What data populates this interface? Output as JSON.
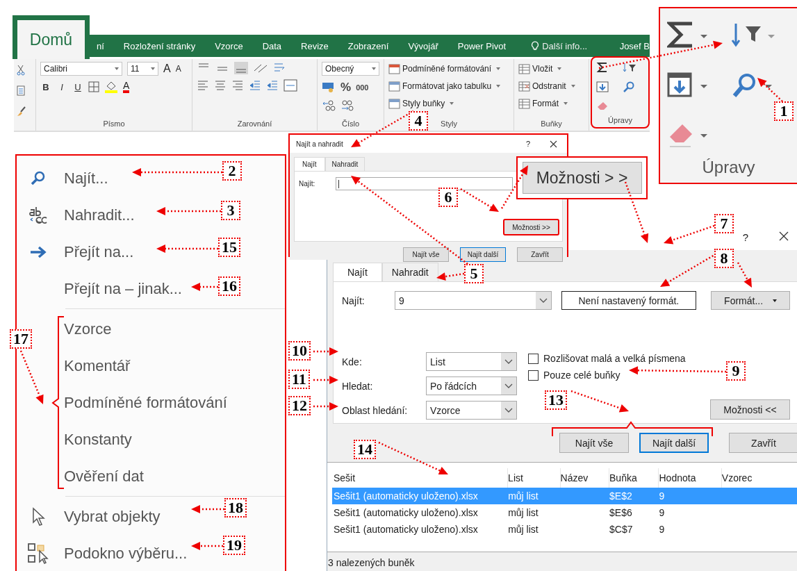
{
  "ribbon": {
    "tabs": [
      {
        "label": "Domů",
        "selected": true
      },
      {
        "label": "ní",
        "selected": false
      },
      {
        "label": "Rozložení stránky",
        "selected": false
      },
      {
        "label": "Vzorce",
        "selected": false
      },
      {
        "label": "Data",
        "selected": false
      },
      {
        "label": "Revize",
        "selected": false
      },
      {
        "label": "Zobrazení",
        "selected": false
      },
      {
        "label": "Vývojář",
        "selected": false
      },
      {
        "label": "Power Pivot",
        "selected": false
      }
    ],
    "tell_me": "Další info...",
    "user": "Josef B",
    "font_name": "Calibri",
    "font_size": "11",
    "grow_buttons": [
      "A",
      "A"
    ],
    "style_buttons": [
      "B",
      "I",
      "U"
    ],
    "font_color_button": "A",
    "number_format": "Obecný",
    "number_buttons": [
      "%",
      "000"
    ],
    "groups": [
      "Písmo",
      "Zarovnání",
      "Číslo",
      "Styly",
      "Buňky",
      "Úpravy"
    ],
    "styles_items": [
      "Podmíněné formátování",
      "Formátovat jako tabulku",
      "Styly buňky"
    ],
    "cells_items": [
      "Vložit",
      "Odstranit",
      "Formát"
    ]
  },
  "editing_zoom": {
    "label": "Úpravy"
  },
  "small_dialog": {
    "title": "Najít a nahradit",
    "help": "?",
    "tabs": [
      {
        "label": "Najít",
        "selected": true
      },
      {
        "label": "Nahradit",
        "selected": false
      }
    ],
    "find_label": "Najít:",
    "options_button": "Možnosti >>",
    "buttons": [
      "Najít vše",
      "Najít další",
      "Zavřít"
    ]
  },
  "options_zoom": "Možnosti > >",
  "dialog": {
    "help": "?",
    "tabs": [
      {
        "label": "Najít",
        "selected": true
      },
      {
        "label": "Nahradit",
        "selected": false
      }
    ],
    "find_label": "Najít:",
    "find_value": "9",
    "format_status": "Není nastavený formát.",
    "format_button": "Formát...",
    "options": [
      {
        "label": "Kde:",
        "value": "List"
      },
      {
        "label": "Hledat:",
        "value": "Po řádcích"
      },
      {
        "label": "Oblast hledání:",
        "value": "Vzorce"
      }
    ],
    "checkboxes": [
      {
        "label": "Rozlišovat malá a velká písmena",
        "checked": false
      },
      {
        "label": "Pouze celé buňky",
        "checked": false
      }
    ],
    "options_button": "Možnosti <<",
    "buttons": [
      "Najít vše",
      "Najít další",
      "Zavřít"
    ],
    "table": {
      "columns": [
        "Sešit",
        "List",
        "Název",
        "Buňka",
        "Hodnota",
        "Vzorec"
      ],
      "rows": [
        {
          "cells": [
            "Sešit1 (automaticky uloženo).xlsx",
            "můj list",
            "",
            "$E$2",
            "9",
            ""
          ],
          "selected": true
        },
        {
          "cells": [
            "Sešit1 (automaticky uloženo).xlsx",
            "můj list",
            "",
            "$E$6",
            "9",
            ""
          ],
          "selected": false
        },
        {
          "cells": [
            "Sešit1 (automaticky uloženo).xlsx",
            "můj list",
            "",
            "$C$7",
            "9",
            ""
          ],
          "selected": false
        }
      ]
    },
    "status": "3 nalezených buněk"
  },
  "menu": {
    "sections": [
      [
        {
          "kind": "find",
          "label": "Najít..."
        },
        {
          "kind": "replace",
          "label": "Nahradit..."
        },
        {
          "kind": "goto",
          "label": "Přejít na..."
        },
        {
          "kind": "plain",
          "label": "Přejít na – jinak..."
        }
      ],
      [
        {
          "kind": "plain",
          "label": "Vzorce"
        },
        {
          "kind": "plain",
          "label": "Komentář"
        },
        {
          "kind": "plain",
          "label": "Podmíněné formátování"
        },
        {
          "kind": "plain",
          "label": "Konstanty"
        },
        {
          "kind": "plain",
          "label": "Ověření dat"
        }
      ],
      [
        {
          "kind": "pointer",
          "label": "Vybrat objekty"
        },
        {
          "kind": "pane",
          "label": "Podokno výběru..."
        }
      ]
    ]
  },
  "callouts": [
    "1",
    "2",
    "3",
    "15",
    "16",
    "17",
    "18",
    "19",
    "4",
    "5",
    "6",
    "7",
    "8",
    "9",
    "10",
    "11",
    "12",
    "13",
    "14"
  ]
}
